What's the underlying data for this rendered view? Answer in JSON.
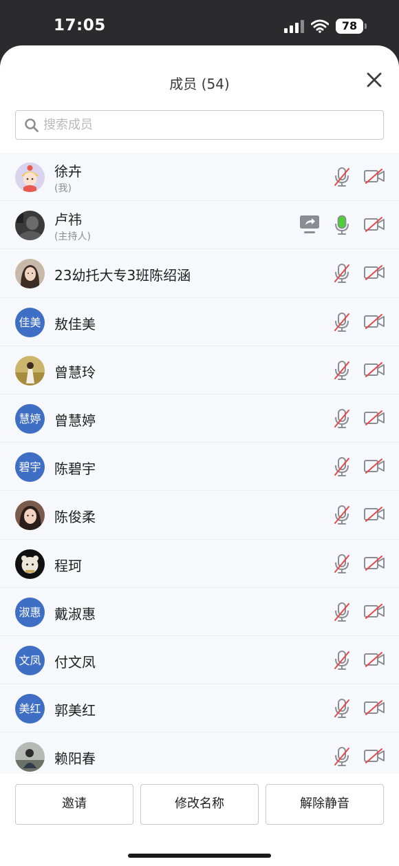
{
  "status_bar": {
    "time": "17:05",
    "battery": "78"
  },
  "header": {
    "title": "成员 (54)"
  },
  "search": {
    "placeholder": "搜索成员",
    "value": ""
  },
  "members": [
    {
      "name": "徐卉",
      "role": "(我)",
      "avatar_type": "photo",
      "avatar": "cartoon-girl-avatar",
      "mic": "muted",
      "camera": "off"
    },
    {
      "name": "卢祎",
      "role": "(主持人)",
      "avatar_type": "photo",
      "avatar": "dark-photo-avatar",
      "mic": "active",
      "camera": "off",
      "sharing": true
    },
    {
      "name": "23幼托大专3班陈绍涵",
      "role": "",
      "avatar_type": "photo",
      "avatar": "portrait-photo-avatar",
      "mic": "muted",
      "camera": "off"
    },
    {
      "name": "敖佳美",
      "role": "",
      "avatar_type": "initials",
      "initials": "佳美",
      "mic": "muted",
      "camera": "off"
    },
    {
      "name": "曾慧玲",
      "role": "",
      "avatar_type": "photo",
      "avatar": "field-photo-avatar",
      "mic": "muted",
      "camera": "off"
    },
    {
      "name": "曾慧婷",
      "role": "",
      "avatar_type": "initials",
      "initials": "慧婷",
      "mic": "muted",
      "camera": "off"
    },
    {
      "name": "陈碧宇",
      "role": "",
      "avatar_type": "initials",
      "initials": "碧宇",
      "mic": "muted",
      "camera": "off"
    },
    {
      "name": "陈俊柔",
      "role": "",
      "avatar_type": "photo",
      "avatar": "selfie-photo-avatar",
      "mic": "muted",
      "camera": "off"
    },
    {
      "name": "程珂",
      "role": "",
      "avatar_type": "photo",
      "avatar": "plush-toy-avatar",
      "mic": "muted",
      "camera": "off"
    },
    {
      "name": "戴淑惠",
      "role": "",
      "avatar_type": "initials",
      "initials": "淑惠",
      "mic": "muted",
      "camera": "off"
    },
    {
      "name": "付文凤",
      "role": "",
      "avatar_type": "initials",
      "initials": "文凤",
      "mic": "muted",
      "camera": "off"
    },
    {
      "name": "郭美红",
      "role": "",
      "avatar_type": "initials",
      "initials": "美红",
      "mic": "muted",
      "camera": "off"
    },
    {
      "name": "赖阳春",
      "role": "",
      "avatar_type": "photo",
      "avatar": "outdoor-photo-avatar",
      "mic": "muted",
      "camera": "off"
    }
  ],
  "actions": {
    "invite": "邀请",
    "rename": "修改名称",
    "unmute": "解除静音"
  },
  "colors": {
    "accent": "#3f6fc4",
    "muted_slash": "#e24a4a",
    "mic_active": "#4cd137"
  }
}
